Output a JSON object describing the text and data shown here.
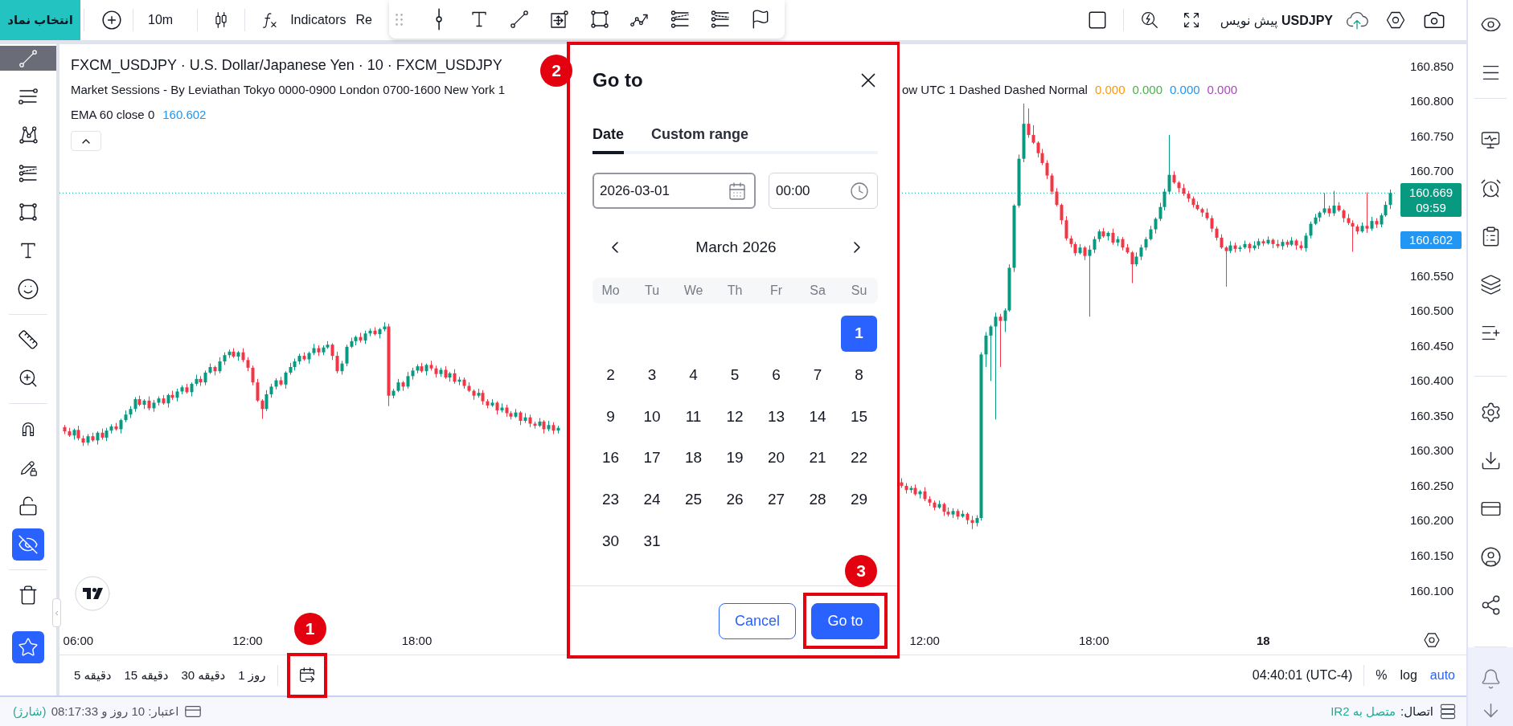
{
  "top_bar": {
    "symbol_button": "انتخاب نماد",
    "interval": "10m",
    "indicators": "Indicators",
    "cut_label": "Re",
    "layout_name": "**USDJPY** پیش نویس"
  },
  "left_toolbar": {
    "tools": [
      {
        "kind": "trendline",
        "selected": true
      },
      {
        "kind": "hlines",
        "selected": false
      },
      {
        "kind": "pattern",
        "selected": false
      },
      {
        "kind": "fib",
        "selected": false
      },
      {
        "kind": "rectangle",
        "selected": false
      },
      {
        "kind": "text",
        "selected": false
      },
      {
        "kind": "sticker",
        "selected": false
      }
    ],
    "toggles": [
      {
        "kind": "magnet",
        "on": false
      },
      {
        "kind": "pencil",
        "on": false
      },
      {
        "kind": "lock",
        "on": false
      },
      {
        "kind": "hide",
        "on": true
      }
    ],
    "favorites": {
      "on": true
    }
  },
  "chart": {
    "legend": {
      "title": "FXCM_USDJPY · U.S. Dollar/Japanese Yen · 10 · FXCM_USDJPY",
      "sessions": "Market Sessions - By Leviathan Tokyo 0000-0900 London 0700-1600 New York 1",
      "sessions_continued": "ow UTC 1 Dashed Dashed Normal",
      "session_values": [
        {
          "text": "0.000",
          "color": "#ff9800"
        },
        {
          "text": "0.000",
          "color": "#4caf50"
        },
        {
          "text": "0.000",
          "color": "#2196f3"
        },
        {
          "text": "0.000",
          "color": "#ab47bc"
        }
      ],
      "ema": {
        "label": "EMA 60 close 0",
        "value": "160.602"
      }
    },
    "last_price": {
      "value": "160.669",
      "countdown": "09:59"
    },
    "ema_price": "160.602",
    "chart_data": {
      "type": "candlestick",
      "ylim": [
        160.1,
        160.85
      ],
      "yticks": [
        {
          "value": 160.85,
          "label": "160.850"
        },
        {
          "value": 160.8,
          "label": "160.800"
        },
        {
          "value": 160.75,
          "label": "160.750"
        },
        {
          "value": 160.7,
          "label": "160.700"
        },
        {
          "value": 160.55,
          "label": "160.550"
        },
        {
          "value": 160.5,
          "label": "160.500"
        },
        {
          "value": 160.45,
          "label": "160.450"
        },
        {
          "value": 160.4,
          "label": "160.400"
        },
        {
          "value": 160.35,
          "label": "160.350"
        },
        {
          "value": 160.3,
          "label": "160.300"
        },
        {
          "value": 160.25,
          "label": "160.250"
        },
        {
          "value": 160.2,
          "label": "160.200"
        },
        {
          "value": 160.15,
          "label": "160.150"
        },
        {
          "value": 160.1,
          "label": "160.100"
        }
      ],
      "ref_lines": [
        {
          "axis": "y",
          "value": 160.669,
          "color": "#089981"
        }
      ],
      "categories": [
        null,
        null,
        null,
        "06:00",
        null,
        null,
        null,
        null,
        null,
        null,
        null,
        null,
        null,
        null,
        null,
        null,
        null,
        null,
        null,
        null,
        null,
        null,
        null,
        null,
        null,
        null,
        null,
        null,
        null,
        null,
        null,
        null,
        null,
        null,
        null,
        null,
        null,
        null,
        null,
        "12:00",
        null,
        null,
        null,
        null,
        null,
        null,
        null,
        null,
        null,
        null,
        null,
        null,
        null,
        null,
        null,
        null,
        null,
        null,
        null,
        null,
        null,
        null,
        null,
        null,
        null,
        null,
        null,
        null,
        null,
        null,
        null,
        null,
        null,
        null,
        null,
        "18:00",
        null,
        null,
        null,
        null,
        null,
        null,
        null,
        null,
        null,
        null,
        null,
        null,
        null,
        null,
        null,
        null,
        null,
        null,
        null,
        null,
        null,
        null,
        null,
        null,
        null,
        null,
        null,
        null,
        null,
        null,
        null,
        null,
        null,
        null,
        null,
        null,
        null,
        null,
        null,
        null,
        null,
        null,
        null,
        null,
        null,
        null,
        null,
        null,
        null,
        null,
        null,
        null,
        null,
        null,
        null,
        null,
        null,
        null,
        null,
        null,
        null,
        null,
        null,
        null,
        null,
        null,
        null,
        null,
        null,
        null,
        null,
        null,
        null,
        null,
        null,
        null,
        null,
        null,
        null,
        null,
        null,
        null,
        null,
        null,
        null,
        null,
        null,
        null,
        null,
        null,
        null,
        null,
        null,
        null,
        null,
        null,
        null,
        null,
        null,
        null,
        null,
        null,
        null,
        null,
        null,
        null,
        null,
        "12:00",
        null,
        null,
        null,
        null,
        null,
        null,
        null,
        null,
        null,
        null,
        null,
        null,
        null,
        null,
        null,
        null,
        null,
        null,
        null,
        null,
        null,
        null,
        null,
        null,
        null,
        null,
        null,
        null,
        null,
        null,
        null,
        null,
        null,
        null,
        null,
        "18:00",
        null,
        null,
        null,
        null,
        null,
        null,
        null,
        null,
        null,
        null,
        null,
        null,
        null,
        null,
        null,
        null,
        null,
        null,
        null,
        null,
        null,
        null,
        null,
        null,
        null,
        null,
        null,
        null,
        null,
        null,
        null,
        null,
        null,
        null,
        null,
        "18",
        null,
        null,
        null,
        null,
        null,
        null,
        null,
        null,
        null,
        null,
        null,
        null,
        null,
        null,
        null,
        null,
        null,
        null,
        null,
        null,
        null,
        null,
        null,
        null,
        null,
        null,
        null
      ],
      "ohlc": [
        [
          160.334,
          160.337,
          160.324,
          160.328
        ],
        [
          160.328,
          160.333,
          160.32,
          160.322
        ],
        [
          160.322,
          160.332,
          160.316,
          160.33
        ],
        [
          160.33,
          160.336,
          160.315,
          160.318
        ],
        [
          160.318,
          160.322,
          160.307,
          160.312
        ],
        [
          160.312,
          160.324,
          160.308,
          160.321
        ],
        [
          160.321,
          160.326,
          160.313,
          160.315
        ],
        [
          160.315,
          160.328,
          160.309,
          160.326
        ],
        [
          160.326,
          160.332,
          160.316,
          160.319
        ],
        [
          160.319,
          160.333,
          160.314,
          160.329
        ],
        [
          160.329,
          160.338,
          160.325,
          160.335
        ],
        [
          160.335,
          160.34,
          160.329,
          160.331
        ],
        [
          160.331,
          160.346,
          160.325,
          160.344
        ],
        [
          160.344,
          160.358,
          160.341,
          160.352
        ],
        [
          160.352,
          160.364,
          160.347,
          160.36
        ],
        [
          160.36,
          160.377,
          160.356,
          160.374
        ],
        [
          160.374,
          160.379,
          160.364,
          160.366
        ],
        [
          160.366,
          160.374,
          160.36,
          160.372
        ],
        [
          160.372,
          160.378,
          160.358,
          160.361
        ],
        [
          160.361,
          160.373,
          160.356,
          160.369
        ],
        [
          160.369,
          160.378,
          160.365,
          160.375
        ],
        [
          160.375,
          160.38,
          160.366,
          160.368
        ],
        [
          160.368,
          160.382,
          160.362,
          160.38
        ],
        [
          160.38,
          160.386,
          160.373,
          160.376
        ],
        [
          160.376,
          160.389,
          160.371,
          160.385
        ],
        [
          160.385,
          160.394,
          160.381,
          160.391
        ],
        [
          160.391,
          160.396,
          160.382,
          160.384
        ],
        [
          160.384,
          160.398,
          160.378,
          160.396
        ],
        [
          160.396,
          160.409,
          160.393,
          160.403
        ],
        [
          160.403,
          160.407,
          160.393,
          160.398
        ],
        [
          160.398,
          160.415,
          160.394,
          160.412
        ],
        [
          160.412,
          160.425,
          160.41,
          160.42
        ],
        [
          160.42,
          160.422,
          160.408,
          160.414
        ],
        [
          160.414,
          160.434,
          160.411,
          160.428
        ],
        [
          160.428,
          160.441,
          160.423,
          160.437
        ],
        [
          160.437,
          160.445,
          160.433,
          160.442
        ],
        [
          160.442,
          160.447,
          160.433,
          160.435
        ],
        [
          160.435,
          160.443,
          160.429,
          160.441
        ],
        [
          160.441,
          160.447,
          160.427,
          160.43
        ],
        [
          160.43,
          160.434,
          160.414,
          160.419
        ],
        [
          160.419,
          160.422,
          160.394,
          160.398
        ],
        [
          160.398,
          160.403,
          160.37,
          160.372
        ],
        [
          160.372,
          160.374,
          160.346,
          160.36
        ],
        [
          160.36,
          160.387,
          160.357,
          160.381
        ],
        [
          160.381,
          160.396,
          160.376,
          160.392
        ],
        [
          160.392,
          160.404,
          160.388,
          160.401
        ],
        [
          160.401,
          160.406,
          160.393,
          160.395
        ],
        [
          160.395,
          160.414,
          160.389,
          160.412
        ],
        [
          160.412,
          160.426,
          160.409,
          160.42
        ],
        [
          160.42,
          160.432,
          160.415,
          160.428
        ],
        [
          160.428,
          160.439,
          160.424,
          160.436
        ],
        [
          160.436,
          160.441,
          160.429,
          160.431
        ],
        [
          160.431,
          160.442,
          160.425,
          160.44
        ],
        [
          160.44,
          160.453,
          160.437,
          160.447
        ],
        [
          160.447,
          160.451,
          160.436,
          160.441
        ],
        [
          160.441,
          160.451,
          160.437,
          160.448
        ],
        [
          160.448,
          160.457,
          160.446,
          160.452
        ],
        [
          160.452,
          160.454,
          160.43,
          160.436
        ],
        [
          160.436,
          160.442,
          160.411,
          160.414
        ],
        [
          160.414,
          160.429,
          160.409,
          160.425
        ],
        [
          160.425,
          160.452,
          160.421,
          160.449
        ],
        [
          160.449,
          160.462,
          160.447,
          160.457
        ],
        [
          160.457,
          160.465,
          160.451,
          160.463
        ],
        [
          160.463,
          160.469,
          160.455,
          160.458
        ],
        [
          160.458,
          160.472,
          160.453,
          160.468
        ],
        [
          160.468,
          160.475,
          160.464,
          160.472
        ],
        [
          160.472,
          160.477,
          160.465,
          160.467
        ],
        [
          160.467,
          160.476,
          160.461,
          160.474
        ],
        [
          160.474,
          160.484,
          160.471,
          160.478
        ],
        [
          160.478,
          160.482,
          160.364,
          160.379
        ],
        [
          160.379,
          160.389,
          160.375,
          160.386
        ],
        [
          160.386,
          160.403,
          160.384,
          160.398
        ],
        [
          160.398,
          160.4,
          160.386,
          160.392
        ],
        [
          160.392,
          160.413,
          160.389,
          160.407
        ],
        [
          160.407,
          160.419,
          160.402,
          160.415
        ],
        [
          160.415,
          160.424,
          160.411,
          160.421
        ],
        [
          160.421,
          160.426,
          160.412,
          160.414
        ],
        [
          160.414,
          160.425,
          160.408,
          160.423
        ],
        [
          160.423,
          160.429,
          160.415,
          160.418
        ],
        [
          160.418,
          160.422,
          160.405,
          160.41
        ],
        [
          160.41,
          160.419,
          160.406,
          160.416
        ],
        [
          160.416,
          160.421,
          160.403,
          160.405
        ],
        [
          160.405,
          160.413,
          160.399,
          160.411
        ],
        [
          160.411,
          160.417,
          160.396,
          160.399
        ],
        [
          160.399,
          160.406,
          160.394,
          160.402
        ],
        [
          160.402,
          160.405,
          160.389,
          160.393
        ],
        [
          160.393,
          160.398,
          160.384,
          160.386
        ],
        [
          160.386,
          160.388,
          160.373,
          160.379
        ],
        [
          160.379,
          160.389,
          160.376,
          160.383
        ],
        [
          160.383,
          160.387,
          160.366,
          160.371
        ],
        [
          160.371,
          160.374,
          160.361,
          160.365
        ],
        [
          160.365,
          160.374,
          160.363,
          160.369
        ],
        [
          160.369,
          160.371,
          160.352,
          160.358
        ],
        [
          160.358,
          160.368,
          160.355,
          160.362
        ],
        [
          160.362,
          160.366,
          160.349,
          160.354
        ],
        [
          160.354,
          160.357,
          160.345,
          160.349
        ],
        [
          160.349,
          160.36,
          160.347,
          160.355
        ],
        [
          160.355,
          160.357,
          160.337,
          160.343
        ],
        [
          160.343,
          160.354,
          160.34,
          160.348
        ],
        [
          160.348,
          160.352,
          160.334,
          160.339
        ],
        [
          160.339,
          160.342,
          160.332,
          160.336
        ],
        [
          160.336,
          160.347,
          160.334,
          160.342
        ],
        [
          160.342,
          160.344,
          160.325,
          160.331
        ],
        [
          160.331,
          160.343,
          160.328,
          160.337
        ],
        [
          160.337,
          160.341,
          160.324,
          160.329
        ],
        [
          160.329,
          160.336,
          160.325,
          160.333
        ],
        null,
        null,
        null,
        null,
        null,
        null,
        null,
        null,
        null,
        null,
        null,
        null,
        null,
        null,
        null,
        null,
        null,
        null,
        null,
        null,
        null,
        null,
        null,
        null,
        null,
        null,
        null,
        null,
        null,
        null,
        null,
        null,
        null,
        null,
        null,
        null,
        null,
        null,
        null,
        null,
        null,
        null,
        null,
        null,
        null,
        null,
        null,
        null,
        null,
        null,
        null,
        null,
        null,
        null,
        null,
        null,
        null,
        null,
        null,
        null,
        null,
        null,
        null,
        null,
        null,
        null,
        null,
        null,
        null,
        null,
        null,
        null,
        [
          160.255,
          160.261,
          160.247,
          160.25
        ],
        [
          160.25,
          160.254,
          160.239,
          160.244
        ],
        [
          160.244,
          160.25,
          160.24,
          160.247
        ],
        [
          160.247,
          160.252,
          160.236,
          160.238
        ],
        [
          160.238,
          160.244,
          160.232,
          160.242
        ],
        [
          160.242,
          160.248,
          160.228,
          160.231
        ],
        [
          160.231,
          160.235,
          160.221,
          160.226
        ],
        [
          160.226,
          160.229,
          160.215,
          160.219
        ],
        [
          160.219,
          160.229,
          160.217,
          160.224
        ],
        [
          160.224,
          160.226,
          160.207,
          160.213
        ],
        [
          160.213,
          160.219,
          160.206,
          160.209
        ],
        [
          160.209,
          160.218,
          160.204,
          160.214
        ],
        [
          160.214,
          160.217,
          160.202,
          160.206
        ],
        [
          160.206,
          160.215,
          160.204,
          160.21
        ],
        [
          160.21,
          160.212,
          160.195,
          160.201
        ],
        [
          160.201,
          160.207,
          160.188,
          160.197
        ],
        [
          160.197,
          160.208,
          160.192,
          160.204
        ],
        [
          160.204,
          160.441,
          160.2,
          160.438
        ],
        [
          160.438,
          160.47,
          160.42,
          160.465
        ],
        [
          160.465,
          160.48,
          160.4,
          160.478
        ],
        [
          160.478,
          160.498,
          160.345,
          160.492
        ],
        [
          160.492,
          160.496,
          160.42,
          160.486
        ],
        [
          160.486,
          160.504,
          160.47,
          160.501
        ],
        [
          160.501,
          160.567,
          160.499,
          160.562
        ],
        [
          160.562,
          160.653,
          160.556,
          160.651
        ],
        [
          160.651,
          160.724,
          160.648,
          160.718
        ],
        [
          160.718,
          160.797,
          160.713,
          160.768
        ],
        [
          160.768,
          160.79,
          160.748,
          160.752
        ],
        [
          160.752,
          160.766,
          160.739,
          160.741
        ],
        [
          160.741,
          160.743,
          160.72,
          160.726
        ],
        [
          160.726,
          160.732,
          160.709,
          160.712
        ],
        [
          160.712,
          160.716,
          160.689,
          160.694
        ],
        [
          160.694,
          160.697,
          160.667,
          160.671
        ],
        [
          160.671,
          160.676,
          160.65,
          160.652
        ],
        [
          160.652,
          160.654,
          160.624,
          160.63
        ],
        [
          160.63,
          160.636,
          160.601,
          160.604
        ],
        [
          160.604,
          160.608,
          160.591,
          160.596
        ],
        [
          160.596,
          160.599,
          160.579,
          160.583
        ],
        [
          160.583,
          160.596,
          160.581,
          160.591
        ],
        [
          160.591,
          160.593,
          160.573,
          160.579
        ],
        [
          160.579,
          160.594,
          160.492,
          160.588
        ],
        [
          160.588,
          160.607,
          160.583,
          160.603
        ],
        [
          160.603,
          160.617,
          160.599,
          160.614
        ],
        [
          160.614,
          160.619,
          160.605,
          160.607
        ],
        [
          160.607,
          160.614,
          160.601,
          160.612
        ],
        [
          160.612,
          160.618,
          160.595,
          160.598
        ],
        [
          160.598,
          160.607,
          160.593,
          160.603
        ],
        [
          160.603,
          160.606,
          160.587,
          160.591
        ],
        [
          160.591,
          160.596,
          160.582,
          160.584
        ],
        [
          160.584,
          160.586,
          160.54,
          160.567
        ],
        [
          160.567,
          160.584,
          160.564,
          160.578
        ],
        [
          160.578,
          160.595,
          160.573,
          160.591
        ],
        [
          160.591,
          160.606,
          160.587,
          160.603
        ],
        [
          160.603,
          160.622,
          160.601,
          160.617
        ],
        [
          160.617,
          160.634,
          160.611,
          160.632
        ],
        [
          160.632,
          160.655,
          160.629,
          160.649
        ],
        [
          160.649,
          160.675,
          160.644,
          160.671
        ],
        [
          160.671,
          160.752,
          160.667,
          160.695
        ],
        [
          160.695,
          160.7,
          160.682,
          160.684
        ],
        [
          160.684,
          160.686,
          160.67,
          160.676
        ],
        [
          160.676,
          160.682,
          160.665,
          160.668
        ],
        [
          160.668,
          160.672,
          160.656,
          160.661
        ],
        [
          160.661,
          160.664,
          160.648,
          160.652
        ],
        [
          160.652,
          160.657,
          160.644,
          160.646
        ],
        [
          160.646,
          160.648,
          160.635,
          160.641
        ],
        [
          160.641,
          160.647,
          160.63,
          160.633
        ],
        [
          160.633,
          160.637,
          160.613,
          160.618
        ],
        [
          160.618,
          160.621,
          160.601,
          160.605
        ],
        [
          160.605,
          160.61,
          160.589,
          160.591
        ],
        [
          160.591,
          160.593,
          160.535,
          160.586
        ],
        [
          160.586,
          160.6,
          160.583,
          160.594
        ],
        [
          160.594,
          160.598,
          160.584,
          160.589
        ],
        [
          160.589,
          160.594,
          160.585,
          160.591
        ],
        [
          160.591,
          160.601,
          160.589,
          160.596
        ],
        [
          160.596,
          160.598,
          160.584,
          160.59
        ],
        [
          160.59,
          160.6,
          160.587,
          160.594
        ],
        [
          160.594,
          160.604,
          160.589,
          160.6
        ],
        [
          160.6,
          160.603,
          160.593,
          160.597
        ],
        [
          160.597,
          160.607,
          160.595,
          160.602
        ],
        [
          160.602,
          160.604,
          160.59,
          160.596
        ],
        [
          160.596,
          160.602,
          160.59,
          160.593
        ],
        [
          160.593,
          160.603,
          160.588,
          160.599
        ],
        [
          160.599,
          160.602,
          160.591,
          160.595
        ],
        [
          160.595,
          160.606,
          160.593,
          160.601
        ],
        [
          160.601,
          160.603,
          160.588,
          160.594
        ],
        [
          160.594,
          160.6,
          160.587,
          160.59
        ],
        [
          160.59,
          160.612,
          160.585,
          160.608
        ],
        [
          160.608,
          160.628,
          160.604,
          160.625
        ],
        [
          160.625,
          160.639,
          160.623,
          160.634
        ],
        [
          160.634,
          160.643,
          160.628,
          160.641
        ],
        [
          160.641,
          160.669,
          160.638,
          160.647
        ],
        [
          160.647,
          160.651,
          160.635,
          160.64
        ],
        [
          160.64,
          160.672,
          160.636,
          160.651
        ],
        [
          160.651,
          160.656,
          160.642,
          160.644
        ],
        [
          160.644,
          160.646,
          160.627,
          160.633
        ],
        [
          160.633,
          160.639,
          160.623,
          160.626
        ],
        [
          160.626,
          160.63,
          160.585,
          160.621
        ],
        [
          160.621,
          160.624,
          160.61,
          160.614
        ],
        [
          160.614,
          160.627,
          160.612,
          160.622
        ],
        [
          160.622,
          160.67,
          160.612,
          160.618
        ],
        [
          160.618,
          160.635,
          160.615,
          160.629
        ],
        [
          160.629,
          160.633,
          160.619,
          160.624
        ],
        [
          160.624,
          160.64,
          160.62,
          160.637
        ],
        [
          160.637,
          160.657,
          160.635,
          160.652
        ],
        [
          160.652,
          160.674,
          160.646,
          160.669
        ]
      ]
    }
  },
  "time_axis": [
    {
      "kind": "time"
    },
    {
      "kind": "time"
    },
    {
      "kind": "time"
    },
    {
      "kind": "time"
    },
    {
      "kind": "time"
    },
    {
      "kind": "day"
    }
  ],
  "goto_dialog": {
    "annotation": "2",
    "title": "Go to",
    "tabs": [
      {
        "label": "Date",
        "selected": true
      },
      {
        "label": "Custom range",
        "selected": false
      }
    ],
    "date_field": {
      "value": "2026-03-01",
      "focused": true
    },
    "time_field": {
      "value": "00:00",
      "focused": false
    },
    "month": "March 2026",
    "weekdays": [
      "Mo",
      "Tu",
      "We",
      "Th",
      "Fr",
      "Sa",
      "Su"
    ],
    "weeks": [
      [
        {
          "label": "1",
          "selected": true
        }
      ],
      [
        {
          "label": "2",
          "selected": false
        },
        {
          "label": "3",
          "selected": false
        },
        {
          "label": "4",
          "selected": false
        },
        {
          "label": "5",
          "selected": false
        },
        {
          "label": "6",
          "selected": false
        },
        {
          "label": "7",
          "selected": false
        },
        {
          "label": "8",
          "selected": false
        }
      ],
      [
        {
          "label": "9",
          "selected": false
        },
        {
          "label": "10",
          "selected": false
        },
        {
          "label": "11",
          "selected": false
        },
        {
          "label": "12",
          "selected": false
        },
        {
          "label": "13",
          "selected": false
        },
        {
          "label": "14",
          "selected": false
        },
        {
          "label": "15",
          "selected": false
        }
      ],
      [
        {
          "label": "16",
          "selected": false
        },
        {
          "label": "17",
          "selected": false
        },
        {
          "label": "18",
          "selected": false
        },
        {
          "label": "19",
          "selected": false
        },
        {
          "label": "20",
          "selected": false
        },
        {
          "label": "21",
          "selected": false
        },
        {
          "label": "22",
          "selected": false
        }
      ],
      [
        {
          "label": "23",
          "selected": false
        },
        {
          "label": "24",
          "selected": false
        },
        {
          "label": "25",
          "selected": false
        },
        {
          "label": "26",
          "selected": false
        },
        {
          "label": "27",
          "selected": false
        },
        {
          "label": "28",
          "selected": false
        },
        {
          "label": "29",
          "selected": false
        }
      ],
      [
        {
          "label": "30",
          "selected": false
        },
        {
          "label": "31",
          "selected": false
        }
      ]
    ],
    "buttons": [
      {
        "label": "Cancel",
        "kind": "secondary"
      },
      {
        "label": "Go to",
        "kind": "primary",
        "annotation": "3"
      }
    ]
  },
  "bottom_bar": {
    "intervals": [
      "1 روز",
      "30 دقیقه",
      "15 دقیقه",
      "5 دقیقه"
    ],
    "goto_button": {
      "annotation": "1"
    },
    "timezone": "04:40:01 (UTC-4)",
    "scale_toggles": [
      {
        "label": "%",
        "selected": false
      },
      {
        "label": "log",
        "selected": false
      },
      {
        "label": "auto",
        "selected": true
      }
    ]
  },
  "status_bar": {
    "credit": "اعتبار: 10 روز و 08:17:33",
    "recharge": "(شارژ)",
    "connection_label": "اتصال:",
    "connection_value": "متصل به IR2"
  }
}
